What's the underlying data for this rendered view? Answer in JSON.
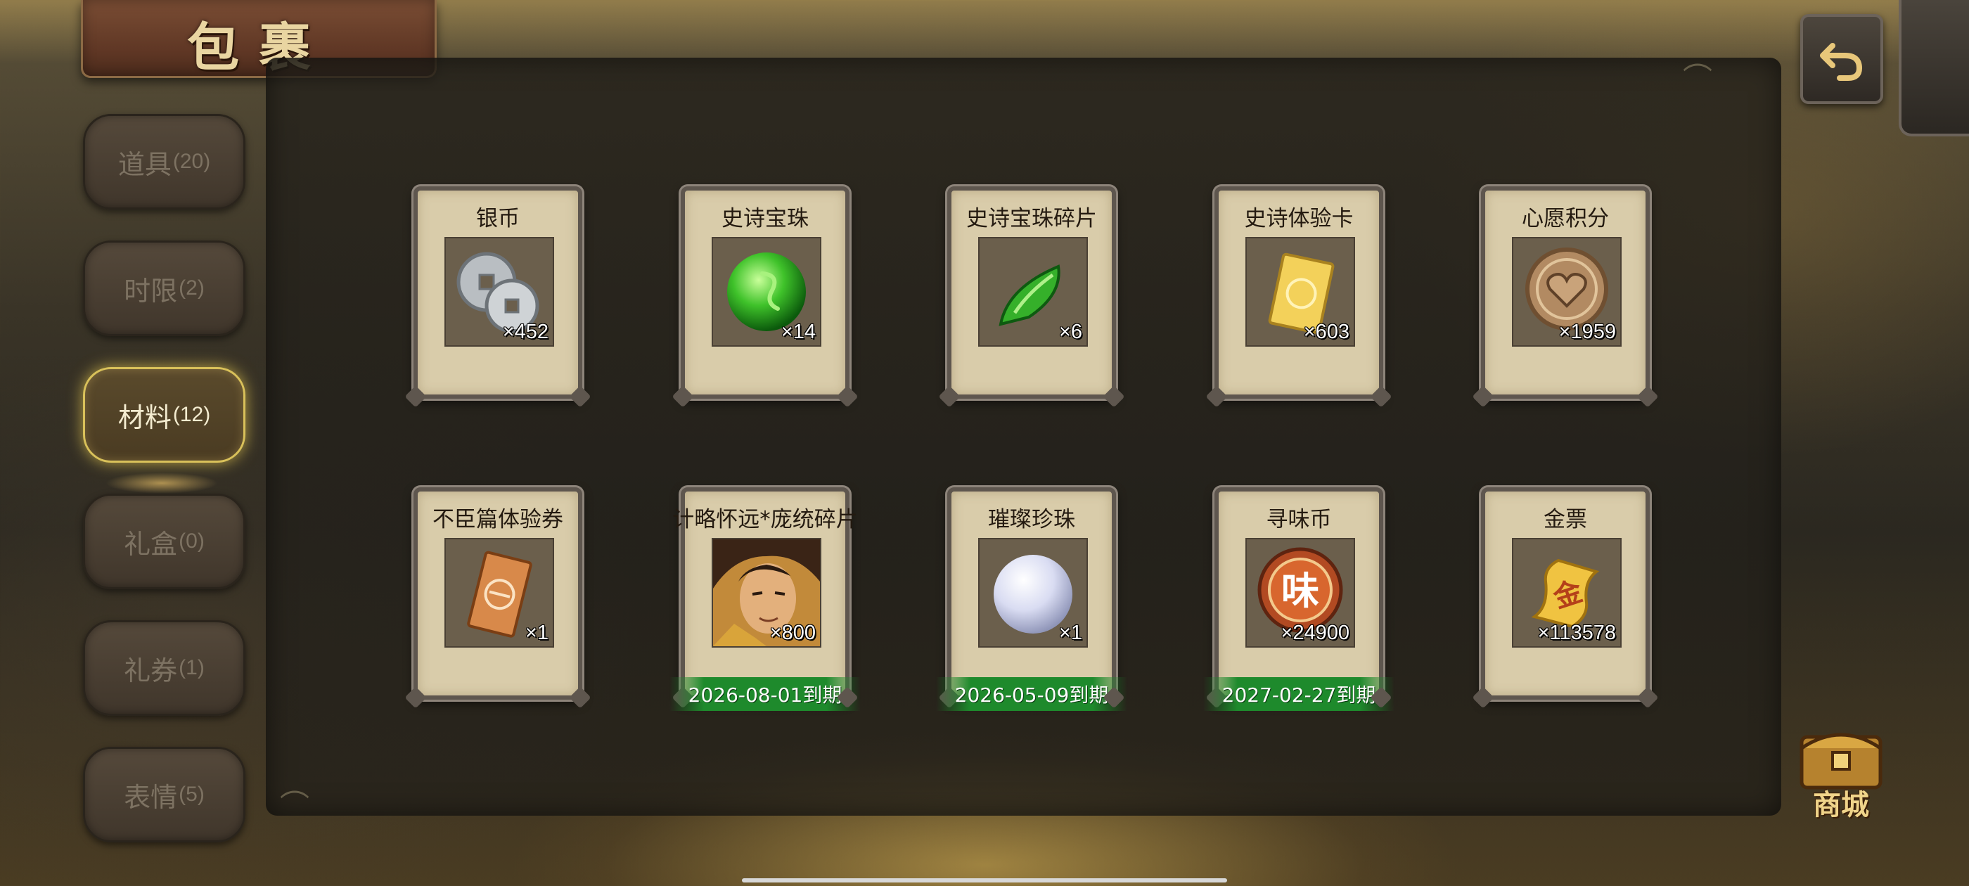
{
  "header": {
    "title": "包裹"
  },
  "tabs": [
    {
      "label": "道具",
      "count": "(20)"
    },
    {
      "label": "时限",
      "count": "(2)"
    },
    {
      "label": "材料",
      "count": "(12)",
      "active": true
    },
    {
      "label": "礼盒",
      "count": "(0)"
    },
    {
      "label": "礼券",
      "count": "(1)"
    },
    {
      "label": "表情",
      "count": "(5)"
    }
  ],
  "items": [
    {
      "name": "银币",
      "quantity": "×452",
      "icon": "silver-coins-icon"
    },
    {
      "name": "史诗宝珠",
      "quantity": "×14",
      "icon": "green-orb-icon"
    },
    {
      "name": "史诗宝珠碎片",
      "quantity": "×6",
      "icon": "green-shard-icon"
    },
    {
      "name": "史诗体验卡",
      "quantity": "×603",
      "icon": "gold-card-icon"
    },
    {
      "name": "心愿积分",
      "quantity": "×1959",
      "icon": "heart-coin-icon"
    },
    {
      "name": "不臣篇体验券",
      "quantity": "×1",
      "icon": "ticket-icon"
    },
    {
      "name": "计略怀远*庞统碎片",
      "quantity": "×800",
      "icon": "hero-portrait-icon",
      "expiry": "2026-08-01到期"
    },
    {
      "name": "璀璨珍珠",
      "quantity": "×1",
      "icon": "pearl-icon",
      "expiry": "2026-05-09到期"
    },
    {
      "name": "寻味币",
      "quantity": "×24900",
      "icon": "wei-coin-icon",
      "coin_char": "味",
      "expiry": "2027-02-27到期"
    },
    {
      "name": "金票",
      "quantity": "×113578",
      "icon": "gold-ticket-icon",
      "ticket_char": "金"
    }
  ],
  "shop": {
    "label": "商城"
  },
  "colors": {
    "active_tab_border": "#d9c15a",
    "expiry_green": "#1e8a2c",
    "card_bg": "#d9ccaa"
  }
}
